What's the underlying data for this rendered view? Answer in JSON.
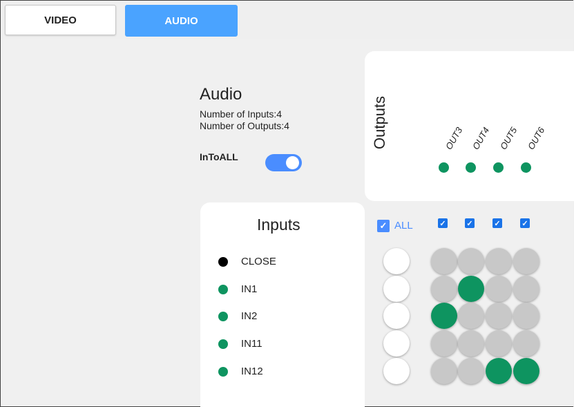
{
  "tabs": {
    "video_label": "VIDEO",
    "audio_label": "AUDIO"
  },
  "info": {
    "title": "Audio",
    "inputs_count": "Number of Inputs:4",
    "outputs_count": "Number of Outputs:4",
    "toggle_label": "InToALL",
    "toggle_on": true
  },
  "outputs": {
    "title": "Outputs",
    "labels": [
      "OUT3",
      "OUT4",
      "OUT5",
      "OUT6"
    ]
  },
  "inputs": {
    "title": "Inputs",
    "rows": [
      {
        "label": "CLOSE",
        "color": "#000000"
      },
      {
        "label": "IN1",
        "color": "#0e9460"
      },
      {
        "label": "IN2",
        "color": "#0e9460"
      },
      {
        "label": "IN11",
        "color": "#0e9460"
      },
      {
        "label": "IN12",
        "color": "#0e9460"
      }
    ]
  },
  "matrix": {
    "all_label": "ALL",
    "all_checked": true,
    "column_checked": [
      true,
      true,
      true,
      true
    ],
    "rows": [
      [
        "gray",
        "gray",
        "gray",
        "gray"
      ],
      [
        "gray",
        "green",
        "gray",
        "gray"
      ],
      [
        "green",
        "gray",
        "gray",
        "gray"
      ],
      [
        "gray",
        "gray",
        "gray",
        "gray"
      ],
      [
        "gray",
        "gray",
        "green",
        "green"
      ]
    ]
  },
  "colors": {
    "accent": "#4a8dff",
    "active": "#0e9460",
    "inactive": "#c8c8c8"
  }
}
